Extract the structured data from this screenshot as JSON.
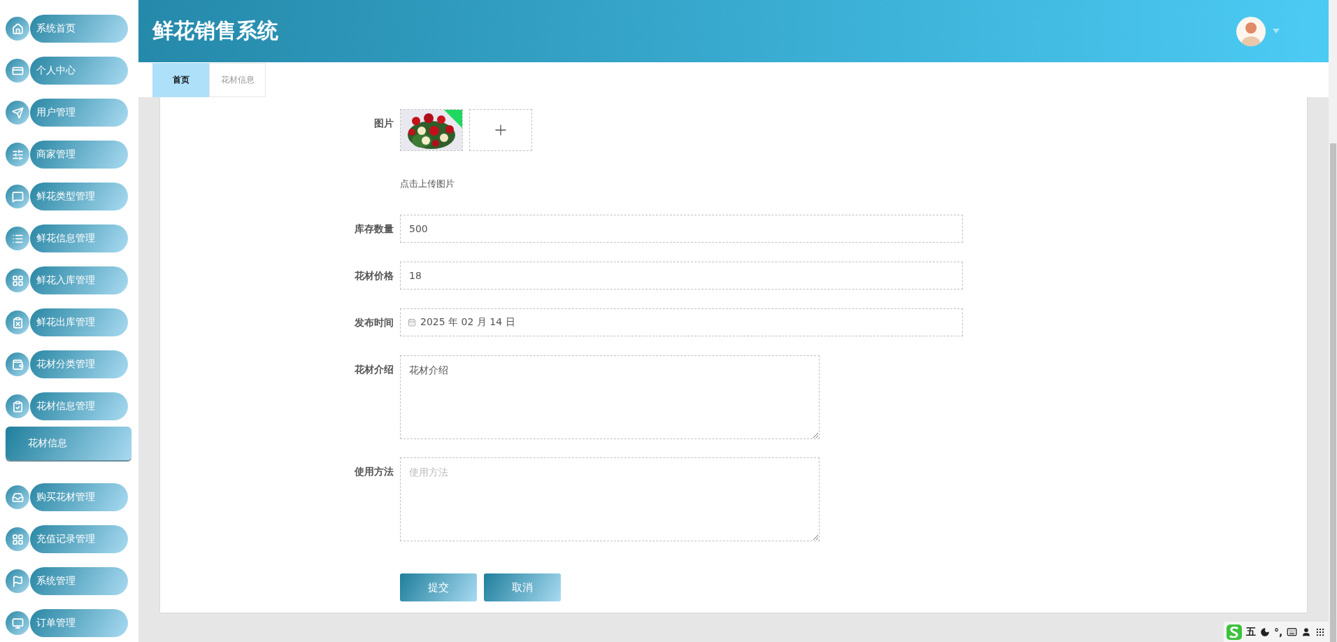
{
  "sidebar": {
    "items": [
      {
        "label": "系统首页"
      },
      {
        "label": "个人中心"
      },
      {
        "label": "用户管理"
      },
      {
        "label": "商家管理"
      },
      {
        "label": "鲜花类型管理"
      },
      {
        "label": "鲜花信息管理"
      },
      {
        "label": "鲜花入库管理"
      },
      {
        "label": "鲜花出库管理"
      },
      {
        "label": "花材分类管理"
      },
      {
        "label": "花材信息管理",
        "children": [
          {
            "label": "花材信息",
            "selected": true
          }
        ]
      },
      {
        "label": "购买花材管理"
      },
      {
        "label": "充值记录管理"
      },
      {
        "label": "系统管理"
      },
      {
        "label": "订单管理"
      }
    ]
  },
  "header": {
    "title": "鲜花销售系统"
  },
  "tabs": [
    {
      "label": "首页",
      "selected": true
    },
    {
      "label": "花材信息",
      "selected": false
    }
  ],
  "form": {
    "image_upload": {
      "label": "图片",
      "hint": "点击上传图片"
    },
    "fields": [
      {
        "kind": "input",
        "label": "库存数量",
        "value": "500"
      },
      {
        "kind": "input",
        "label": "花材价格",
        "value": "18"
      },
      {
        "kind": "date",
        "label": "发布时间",
        "value": "2025 年 02 月 14 日"
      },
      {
        "kind": "textarea",
        "label": "花材介绍",
        "value": "花材介绍"
      },
      {
        "kind": "textarea",
        "label": "使用方法",
        "placeholder": "使用方法"
      }
    ],
    "buttons": [
      "提交",
      "取消"
    ]
  },
  "ime_toolbar": {
    "mode": "五",
    "punctuation": "°,"
  }
}
